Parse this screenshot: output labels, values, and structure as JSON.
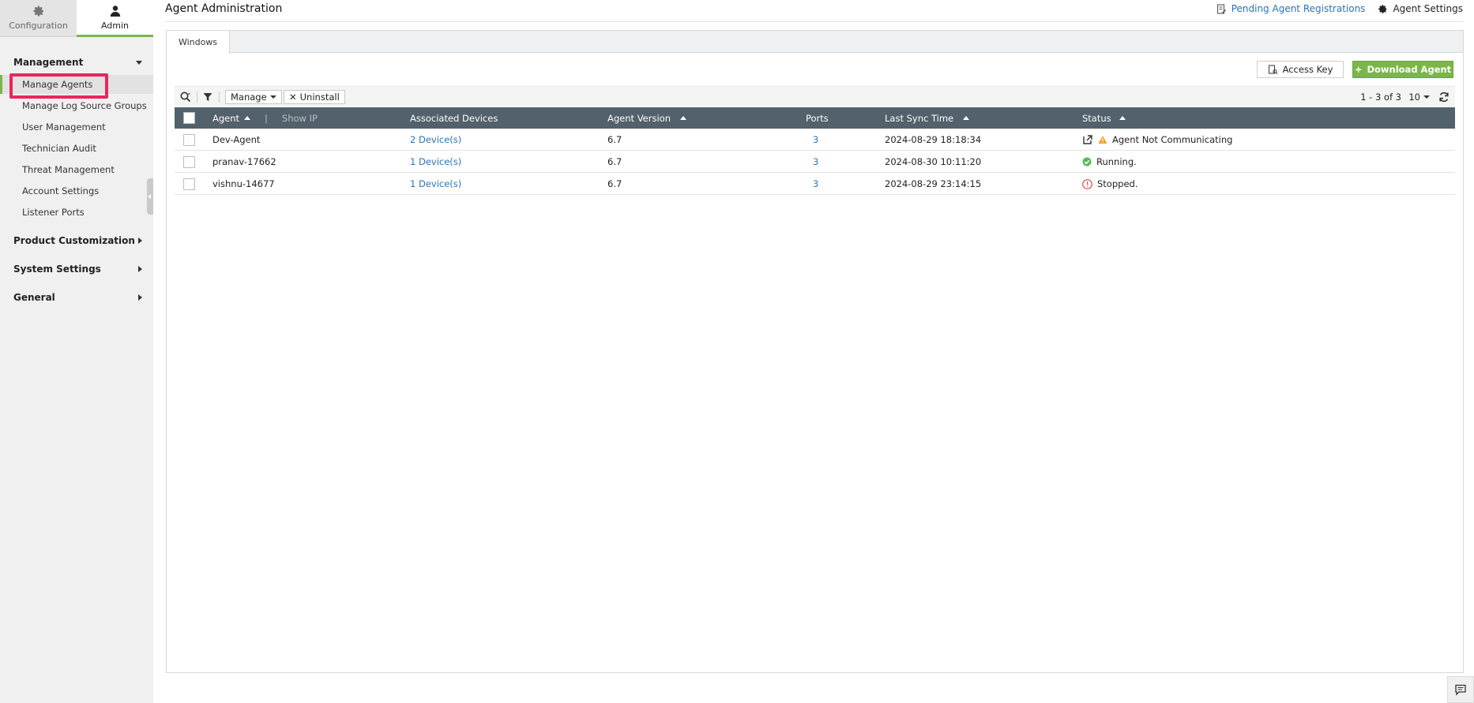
{
  "sidebar": {
    "tabs": [
      {
        "label": "Configuration",
        "icon": "gear-icon",
        "active": false
      },
      {
        "label": "Admin",
        "icon": "user-icon",
        "active": true
      }
    ],
    "groups": {
      "management": {
        "label": "Management",
        "expanded": true,
        "items": [
          {
            "label": "Manage Agents",
            "active": true
          },
          {
            "label": "Manage Log Source Groups"
          },
          {
            "label": "User Management"
          },
          {
            "label": "Technician Audit"
          },
          {
            "label": "Threat Management"
          },
          {
            "label": "Account Settings"
          },
          {
            "label": "Listener Ports"
          }
        ]
      },
      "product_customization": {
        "label": "Product Customization"
      },
      "system_settings": {
        "label": "System Settings"
      },
      "general": {
        "label": "General"
      }
    }
  },
  "header": {
    "title": "Agent Administration",
    "pending_link": "Pending Agent Registrations",
    "agent_settings": "Agent Settings"
  },
  "tabs": [
    {
      "label": "Windows",
      "active": true
    }
  ],
  "actions": {
    "access_key": "Access Key",
    "download_agent": "Download Agent",
    "download_prefix": "+"
  },
  "toolbar": {
    "manage_label": "Manage",
    "uninstall_label": "Uninstall",
    "uninstall_prefix": "✕",
    "pagination": "1 - 3 of 3",
    "per_page": "10"
  },
  "table": {
    "columns": {
      "agent": "Agent",
      "sep": "|",
      "show_ip": "Show IP",
      "devices": "Associated Devices",
      "version": "Agent Version",
      "ports": "Ports",
      "sync": "Last Sync Time",
      "status": "Status"
    },
    "rows": [
      {
        "agent": "Dev-Agent",
        "devices": "2 Device(s)",
        "version": "6.7",
        "ports": "3",
        "sync": "2024-08-29 18:18:34",
        "status": "Agent Not Communicating",
        "status_icon": "warning-icon"
      },
      {
        "agent": "pranav-17662",
        "devices": "1 Device(s)",
        "version": "6.7",
        "ports": "3",
        "sync": "2024-08-30 10:11:20",
        "status": "Running.",
        "status_icon": "check-circle-icon"
      },
      {
        "agent": "vishnu-14677",
        "devices": "1 Device(s)",
        "version": "6.7",
        "ports": "3",
        "sync": "2024-08-29 23:14:15",
        "status": "Stopped.",
        "status_icon": "info-circle-icon"
      }
    ]
  },
  "colors": {
    "accent_green": "#7ab648",
    "table_header": "#52616b",
    "link_blue": "#2b73b6",
    "highlight": "#e8265e",
    "warning": "#f0a030",
    "success": "#5cb85c",
    "error": "#d9534f"
  }
}
